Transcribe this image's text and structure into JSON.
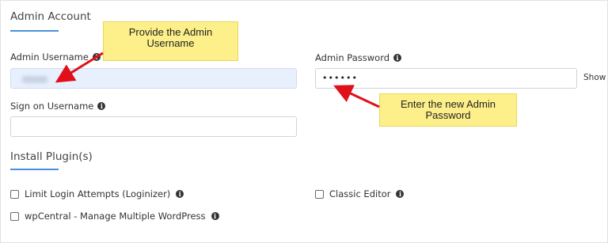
{
  "admin_section": {
    "title": "Admin Account",
    "username_label": "Admin Username",
    "password_label": "Admin Password",
    "password_value": "••••••",
    "show_label": "Show",
    "sign_on_label": "Sign on Username"
  },
  "plugins_section": {
    "title": "Install Plugin(s)",
    "items": [
      {
        "label": "Limit Login Attempts (Loginizer)",
        "checked": false
      },
      {
        "label": "Classic Editor",
        "checked": false
      },
      {
        "label": "wpCentral - Manage Multiple WordPress",
        "checked": false
      }
    ]
  },
  "annotations": {
    "username_callout": "Provide the Admin Username",
    "password_callout": "Enter the new Admin Password"
  },
  "colors": {
    "accent": "#4a90d9",
    "callout": "#fdf08a",
    "arrow": "#e0101a",
    "autofill": "#e8f0fe"
  }
}
